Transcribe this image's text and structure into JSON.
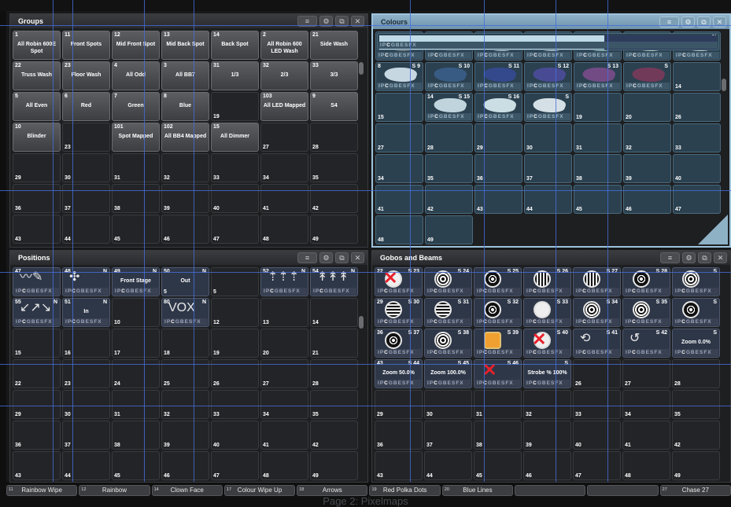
{
  "groups": {
    "title": "Groups",
    "cells": [
      {
        "n": "1",
        "label": "All Robin 600E Spot",
        "type": "btn"
      },
      {
        "n": "11",
        "label": "Front Spots",
        "type": "btn"
      },
      {
        "n": "12",
        "label": "Mid Front Spot",
        "type": "btn"
      },
      {
        "n": "13",
        "label": "Mid Back Spot",
        "type": "btn"
      },
      {
        "n": "14",
        "label": "Back Spot",
        "type": "btn"
      },
      {
        "n": "2",
        "label": "All Robin 600 LED Wash",
        "type": "btn"
      },
      {
        "n": "21",
        "label": "Side Wash",
        "type": "btn"
      },
      {
        "n": "22",
        "label": "Truss Wash",
        "type": "btn"
      },
      {
        "n": "23",
        "label": "Floor Wash",
        "type": "btn"
      },
      {
        "n": "4",
        "label": "All Odd",
        "type": "btn"
      },
      {
        "n": "3",
        "label": "All BB7",
        "type": "btn"
      },
      {
        "n": "31",
        "label": "1/3",
        "type": "btn"
      },
      {
        "n": "32",
        "label": "2/3",
        "type": "btn"
      },
      {
        "n": "33",
        "label": "3/3",
        "type": "btn"
      },
      {
        "n": "5",
        "label": "All Even",
        "type": "btn"
      },
      {
        "n": "6",
        "label": "Red",
        "type": "btn"
      },
      {
        "n": "7",
        "label": "Green",
        "type": "btn"
      },
      {
        "n": "8",
        "label": "Blue",
        "type": "btn"
      },
      {
        "bn": "19",
        "type": "empty"
      },
      {
        "n": "103",
        "label": "All LED Mapped",
        "type": "btn"
      },
      {
        "n": "9",
        "label": "S4",
        "type": "btn"
      },
      {
        "n": "10",
        "label": "Blinder",
        "type": "btn"
      },
      {
        "bn": "23",
        "type": "empty"
      },
      {
        "n": "101",
        "label": "Spot Mapped",
        "type": "btn"
      },
      {
        "n": "102",
        "label": "All BB4 Mapped",
        "type": "btn"
      },
      {
        "n": "15",
        "label": "All Dimmer",
        "type": "btn"
      },
      {
        "bn": "27",
        "type": "empty"
      },
      {
        "bn": "28",
        "type": "empty"
      },
      {
        "bn": "29"
      },
      {
        "bn": "30"
      },
      {
        "bn": "31"
      },
      {
        "bn": "32"
      },
      {
        "bn": "33"
      },
      {
        "bn": "34"
      },
      {
        "bn": "35"
      },
      {
        "bn": "36"
      },
      {
        "bn": "37"
      },
      {
        "bn": "38"
      },
      {
        "bn": "39"
      },
      {
        "bn": "40"
      },
      {
        "bn": "41"
      },
      {
        "bn": "42"
      },
      {
        "bn": "43"
      },
      {
        "bn": "44"
      },
      {
        "bn": "45"
      },
      {
        "bn": "46"
      },
      {
        "bn": "47"
      },
      {
        "bn": "48"
      },
      {
        "bn": "49"
      }
    ]
  },
  "colours": {
    "title": "Colours",
    "cells": [
      {
        "n": "1",
        "flag": "S 2",
        "type": "sw",
        "c": "#8a8a8a",
        "ipc": true
      },
      {
        "n": "",
        "flag": "S 3",
        "type": "sw",
        "c": "#5c6f78",
        "ipc": true
      },
      {
        "n": "",
        "flag": "S 4",
        "type": "sw",
        "c": "#ccdde4",
        "ipc": true
      },
      {
        "n": "",
        "flag": "S 5",
        "type": "sw",
        "c": "#cfe6ec",
        "ipc": true
      },
      {
        "n": "",
        "flag": "S 6",
        "type": "sw",
        "c": "#a9d8d0",
        "ipc": true
      },
      {
        "n": "",
        "flag": "S 7",
        "type": "sw",
        "c": "#b8d8c6",
        "ipc": true
      },
      {
        "n": "",
        "flag": "S",
        "type": "sw",
        "c": "#c8dcd0",
        "ipc": true
      },
      {
        "n": "8",
        "flag": "S 9",
        "type": "sw",
        "c": "#d8e8f2",
        "ipc": true
      },
      {
        "n": "",
        "flag": "S 10",
        "type": "sw",
        "c": "#3a5e88",
        "ipc": true
      },
      {
        "n": "",
        "flag": "S 11",
        "type": "sw",
        "c": "#354a92",
        "ipc": true
      },
      {
        "n": "",
        "flag": "S 12",
        "type": "sw",
        "c": "#4b4d9a",
        "ipc": true
      },
      {
        "n": "",
        "flag": "S 13",
        "type": "sw",
        "c": "#7a4d8a",
        "ipc": true
      },
      {
        "n": "",
        "flag": "S",
        "type": "sw",
        "c": "#7a3a5a",
        "ipc": true
      },
      {
        "bn": "14"
      },
      {
        "bn": "15"
      },
      {
        "n": "14",
        "flag": "S 15",
        "type": "sw",
        "c": "#cfe4ec",
        "ipc": true
      },
      {
        "n": "",
        "flag": "S 16",
        "type": "sw",
        "c": "#dceff4",
        "ipc": true
      },
      {
        "n": "",
        "flag": "S",
        "type": "sw",
        "c": "#e8f2f6",
        "ipc": true
      },
      {
        "bn": "19"
      },
      {
        "bn": "20"
      },
      {
        "n": "17",
        "flag": "",
        "type": "bars",
        "bars": [
          "#9aa7a0",
          "#8a5f5c",
          "#8da58c",
          "#e8f0ee"
        ],
        "ipc": true
      },
      {
        "n": "18",
        "flag": "N 19",
        "type": "bars",
        "bars": [
          "#57768a",
          "#6a9268",
          "#3d4f7a"
        ],
        "ipc": true
      },
      {
        "n": "",
        "flag": "N 2",
        "type": "bars",
        "bars": [
          "#8ab1bd",
          "#4e5f8c",
          "#3a4a73"
        ],
        "ipc": true
      },
      {
        "n": "",
        "flag": "N 2",
        "type": "bars",
        "bars": [
          "#e6eef2",
          "#7fa6bd",
          "#38466f"
        ],
        "ipc": true
      },
      {
        "n": "",
        "flag": "N",
        "type": "bars",
        "bars": [
          "#bfdbe8",
          "#bfdbe8",
          "#2e3c5c"
        ],
        "ipc": true
      },
      {
        "bn": "26"
      },
      {
        "bn": "27"
      },
      {
        "bn": "28"
      },
      {
        "bn": "29"
      },
      {
        "bn": "30"
      },
      {
        "bn": "31"
      },
      {
        "bn": "32"
      },
      {
        "bn": "33"
      },
      {
        "bn": "34"
      },
      {
        "bn": "35"
      },
      {
        "bn": "36"
      },
      {
        "bn": "37"
      },
      {
        "bn": "38"
      },
      {
        "bn": "39"
      },
      {
        "bn": "40"
      },
      {
        "bn": "41"
      },
      {
        "bn": "42"
      },
      {
        "bn": "43"
      },
      {
        "bn": "44"
      },
      {
        "bn": "45"
      },
      {
        "bn": "46"
      },
      {
        "bn": "47"
      },
      {
        "bn": "48"
      },
      {
        "bn": "49"
      }
    ]
  },
  "positions": {
    "title": "Positions",
    "cells": [
      {
        "n": "47",
        "flag": "",
        "type": "dark",
        "glyph": "〰✎",
        "ipc": true
      },
      {
        "n": "48",
        "flag": "N",
        "type": "dark",
        "glyph": "✣",
        "ipc": true
      },
      {
        "n": "49",
        "flag": "N",
        "type": "dark",
        "label": "Front Stage",
        "ipc": true
      },
      {
        "n": "50",
        "flag": "N",
        "type": "dark",
        "label": "Out",
        "ipc": false,
        "bn": "5"
      },
      {
        "bn": "5"
      },
      {
        "n": "52",
        "flag": "N",
        "type": "dark",
        "glyph": "⇡⇡⇡",
        "ipc": true
      },
      {
        "n": "54",
        "flag": "N",
        "type": "dark",
        "glyph": "↟↟↟",
        "ipc": true
      },
      {
        "n": "55",
        "flag": "N",
        "type": "dark",
        "glyph": "↙↗↘",
        "ipc": true
      },
      {
        "n": "51",
        "flag": "N",
        "type": "dark",
        "label": "In",
        "ipc": true
      },
      {
        "bn": "10"
      },
      {
        "n": "80",
        "flag": "N",
        "type": "dark",
        "glyph": "VOX",
        "ipc": true
      },
      {
        "bn": "12"
      },
      {
        "bn": "13"
      },
      {
        "bn": "14"
      },
      {
        "bn": "15"
      },
      {
        "bn": "16"
      },
      {
        "bn": "17"
      },
      {
        "bn": "18"
      },
      {
        "bn": "19"
      },
      {
        "bn": "20"
      },
      {
        "bn": "21"
      },
      {
        "bn": "22"
      },
      {
        "bn": "23"
      },
      {
        "bn": "24"
      },
      {
        "bn": "25"
      },
      {
        "bn": "26"
      },
      {
        "bn": "27"
      },
      {
        "bn": "28"
      },
      {
        "bn": "29"
      },
      {
        "bn": "30"
      },
      {
        "bn": "31"
      },
      {
        "bn": "32"
      },
      {
        "bn": "33"
      },
      {
        "bn": "34"
      },
      {
        "bn": "35"
      },
      {
        "bn": "36"
      },
      {
        "bn": "37"
      },
      {
        "bn": "38"
      },
      {
        "bn": "39"
      },
      {
        "bn": "40"
      },
      {
        "bn": "41"
      },
      {
        "bn": "42"
      },
      {
        "bn": "43"
      },
      {
        "bn": "44"
      },
      {
        "bn": "45"
      },
      {
        "bn": "46"
      },
      {
        "bn": "47"
      },
      {
        "bn": "48"
      },
      {
        "bn": "49"
      }
    ]
  },
  "gobos": {
    "title": "Gobos and Beams",
    "cells": [
      {
        "n": "22",
        "flag": "S 23",
        "type": "dark",
        "gobo": "x",
        "x": true,
        "ipc": true
      },
      {
        "n": "",
        "flag": "S 24",
        "type": "dark",
        "gobo": "d",
        "ipc": true
      },
      {
        "n": "",
        "flag": "S 25",
        "type": "dark",
        "gobo": "s",
        "ipc": true
      },
      {
        "n": "",
        "flag": "S 26",
        "type": "dark",
        "gobo": "v",
        "ipc": true
      },
      {
        "n": "",
        "flag": "S 27",
        "type": "dark",
        "gobo": "v",
        "ipc": true
      },
      {
        "n": "",
        "flag": "S 28",
        "type": "dark",
        "gobo": "s",
        "ipc": true
      },
      {
        "n": "",
        "flag": "S",
        "type": "dark",
        "gobo": "d",
        "ipc": true
      },
      {
        "n": "29",
        "flag": "S 30",
        "type": "dark",
        "gobo": "l",
        "ipc": true
      },
      {
        "n": "",
        "flag": "S 31",
        "type": "dark",
        "gobo": "l",
        "ipc": true
      },
      {
        "n": "",
        "flag": "S 32",
        "type": "dark",
        "gobo": "s",
        "ipc": true
      },
      {
        "n": "",
        "flag": "S 33",
        "type": "dark",
        "gobo": "x",
        "ipc": true
      },
      {
        "n": "",
        "flag": "S 34",
        "type": "dark",
        "gobo": "d",
        "ipc": true
      },
      {
        "n": "",
        "flag": "S 35",
        "type": "dark",
        "gobo": "d",
        "ipc": true
      },
      {
        "n": "",
        "flag": "S",
        "type": "dark",
        "gobo": "s",
        "ipc": true
      },
      {
        "n": "36",
        "flag": "S 37",
        "type": "dark",
        "gobo": "s",
        "ipc": true
      },
      {
        "n": "",
        "flag": "S 38",
        "type": "dark",
        "gobo": "d",
        "ipc": true
      },
      {
        "n": "",
        "flag": "S 39",
        "type": "dark",
        "gobo": "o",
        "ipc": true
      },
      {
        "n": "",
        "flag": "S 40",
        "type": "dark",
        "gobo": "x",
        "x": true,
        "ipc": true
      },
      {
        "n": "",
        "flag": "S 41",
        "type": "dark",
        "glyph": "⟲",
        "ipc": true
      },
      {
        "n": "",
        "flag": "S 42",
        "type": "dark",
        "glyph": "↺",
        "ipc": true
      },
      {
        "n": "",
        "flag": "S",
        "type": "dark",
        "label": "Zoom 0.0%",
        "ipc": true
      },
      {
        "n": "43",
        "flag": "S 44",
        "type": "dark",
        "label": "Zoom 50.0%",
        "ipc": true
      },
      {
        "n": "",
        "flag": "S 45",
        "type": "dark",
        "label": "Zoom 100.0%",
        "ipc": true
      },
      {
        "n": "",
        "flag": "S 46",
        "type": "dark",
        "x": true,
        "ipc": true
      },
      {
        "n": "",
        "flag": "S",
        "type": "dark",
        "label": "Strobe % 100%",
        "ipc": true
      },
      {
        "bn": "26"
      },
      {
        "bn": "27"
      },
      {
        "bn": "28"
      },
      {
        "bn": "29"
      },
      {
        "bn": "30"
      },
      {
        "bn": "31"
      },
      {
        "bn": "32"
      },
      {
        "bn": "33"
      },
      {
        "bn": "34"
      },
      {
        "bn": "35"
      },
      {
        "bn": "36"
      },
      {
        "bn": "37"
      },
      {
        "bn": "38"
      },
      {
        "bn": "39"
      },
      {
        "bn": "40"
      },
      {
        "bn": "41"
      },
      {
        "bn": "42"
      },
      {
        "bn": "43"
      },
      {
        "bn": "44"
      },
      {
        "bn": "45"
      },
      {
        "bn": "46"
      },
      {
        "bn": "47"
      },
      {
        "bn": "48"
      },
      {
        "bn": "49"
      }
    ]
  },
  "ipc_labels": [
    "I",
    "P",
    "C",
    "G",
    "B",
    "E",
    "S",
    "FX"
  ],
  "bottom_bar": [
    {
      "n": "11",
      "label": "Rainbow Wipe"
    },
    {
      "n": "12",
      "label": "Rainbow"
    },
    {
      "n": "14",
      "label": "Clown Face"
    },
    {
      "n": "17",
      "label": "Colour Wipe Up"
    },
    {
      "n": "18",
      "label": "Arrows"
    },
    {
      "n": "19",
      "label": "Red Polka Dots"
    },
    {
      "n": "20",
      "label": "Blue Lines"
    },
    {
      "n": "",
      "label": ""
    },
    {
      "n": "",
      "label": ""
    },
    {
      "n": "27",
      "label": "Chase 27"
    }
  ],
  "page_label": "Page 2: Pixelmaps",
  "panel_icons": [
    "list-icon",
    "gear-icon",
    "layout-icon",
    "close-icon"
  ]
}
